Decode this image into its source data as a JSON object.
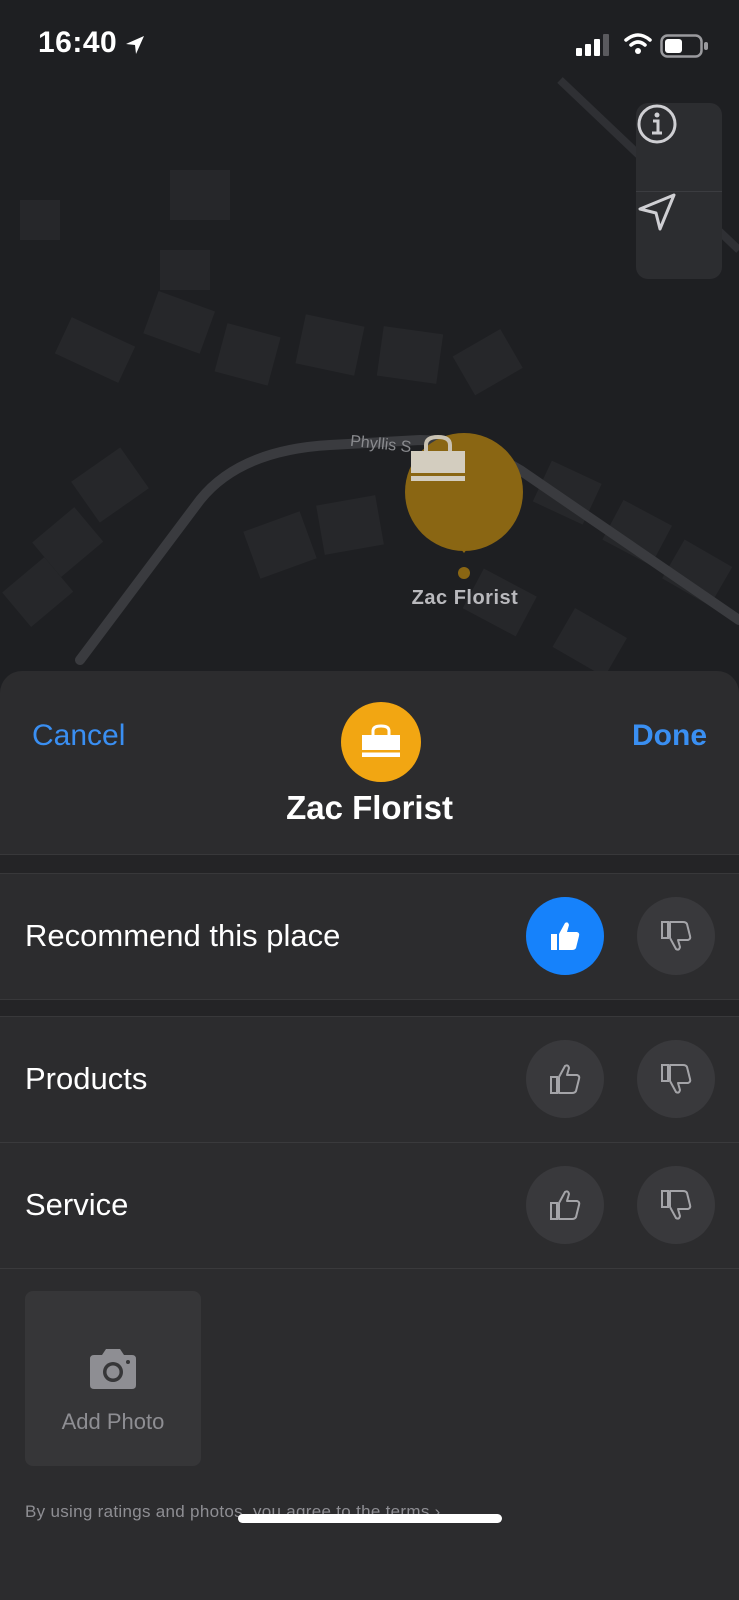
{
  "status_bar": {
    "time": "16:40"
  },
  "map": {
    "street_label": "Phyllis S",
    "pin_label": "Zac Florist",
    "pin_icon": "shopping-bag-icon",
    "pin_color": "#8a6613",
    "controls": [
      {
        "name": "info",
        "icon": "info-icon"
      },
      {
        "name": "location",
        "icon": "location-arrow-icon"
      }
    ]
  },
  "sheet": {
    "cancel_label": "Cancel",
    "done_label": "Done",
    "place_name": "Zac Florist",
    "place_icon": "shopping-bag-icon",
    "accent_color": "#3a8ff2",
    "icon_color": "#f2a612"
  },
  "ratings": [
    {
      "label": "Recommend this place",
      "selected": "up"
    },
    {
      "label": "Products",
      "selected": null
    },
    {
      "label": "Service",
      "selected": null
    }
  ],
  "add_photo": {
    "label": "Add Photo",
    "icon": "camera-icon"
  },
  "terms_text": "By using ratings and photos, you agree to the terms ›"
}
